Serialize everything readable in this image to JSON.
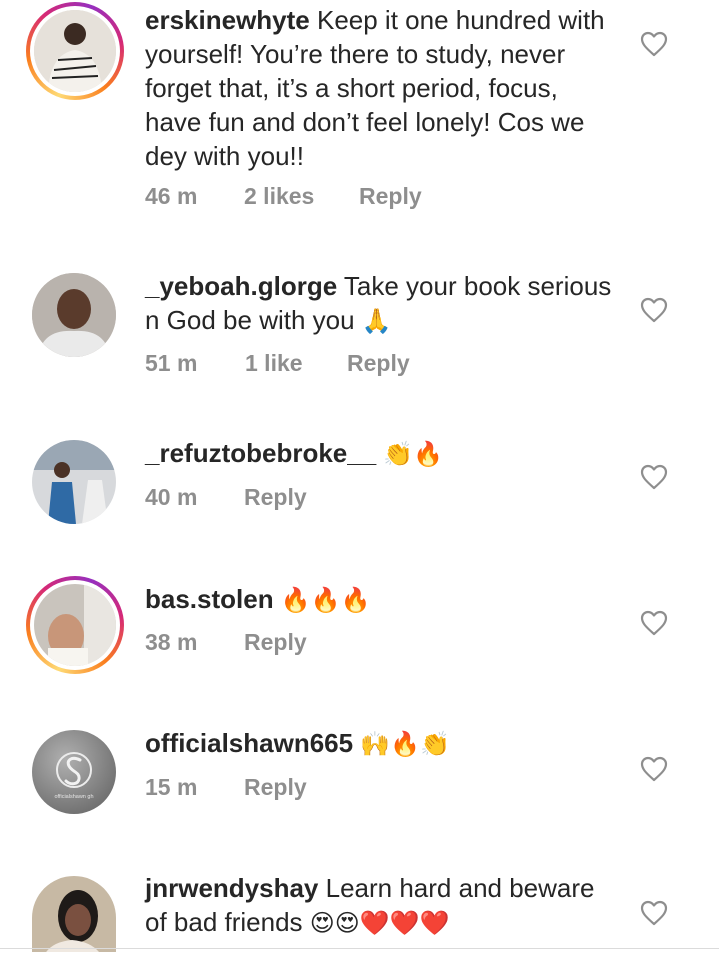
{
  "comments": [
    {
      "username": "erskinewhyte",
      "text": " Keep it one hundred with yourself! You’re there to study, never forget that, it’s a short period, focus, have fun and don’t feel lonely! Cos we dey with you!!",
      "time": "46 m",
      "likes": "2 likes",
      "reply": "Reply",
      "avatar_ring": true
    },
    {
      "username": "_yeboah.glorge",
      "text": " Take your book serious n God be with you ",
      "emoji": "🙏",
      "time": "51 m",
      "likes": "1 like",
      "reply": "Reply",
      "avatar_ring": false
    },
    {
      "username": "_refuztobebroke__",
      "text": " ",
      "emoji": "👏🔥",
      "time": "40 m",
      "reply": "Reply",
      "avatar_ring": false
    },
    {
      "username": "bas.stolen",
      "text": " ",
      "emoji": "🔥🔥🔥",
      "time": "38 m",
      "reply": "Reply",
      "avatar_ring": true
    },
    {
      "username": "officialshawn665",
      "text": " ",
      "emoji": "🙌🔥👏",
      "time": "15 m",
      "reply": "Reply",
      "avatar_ring": false,
      "avatar_caption": "officialshawn gh"
    },
    {
      "username": "jnrwendyshay",
      "text": " Learn hard and beware of bad friends ",
      "emoji": "😍😍❤️❤️❤️",
      "avatar_ring": false
    }
  ],
  "colors": {
    "text": "#262626",
    "meta": "#8e8e8e",
    "heart_stroke": "#8e8e8e"
  },
  "icons": {
    "like": "heart-outline-icon"
  }
}
